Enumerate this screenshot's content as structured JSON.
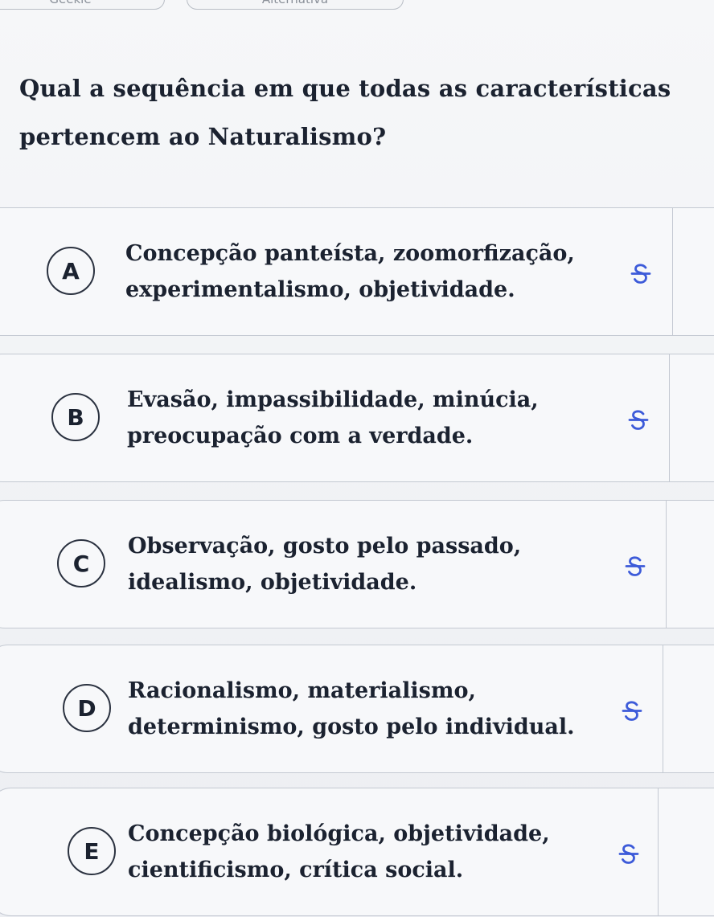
{
  "tabs": {
    "left_label": "Geekie",
    "right_label": "Alternativa"
  },
  "question": {
    "text": "Qual a sequência em que todas as características pertencem ao Naturalismo?"
  },
  "options": [
    {
      "letter": "A",
      "line1": "Concepção panteísta, zoomorfização,",
      "line2": "experimentalismo, objetividade."
    },
    {
      "letter": "B",
      "line1": "Evasão, impassibilidade, minúcia,",
      "line2": "preocupação com a verdade."
    },
    {
      "letter": "C",
      "line1": "Observação, gosto pelo passado,",
      "line2": "idealismo, objetividade."
    },
    {
      "letter": "D",
      "line1": "Racionalismo, materialismo,",
      "line2": "determinismo, gosto pelo individual."
    },
    {
      "letter": "E",
      "line1": "Concepção biológica, objetividade,",
      "line2": "cientificismo, crítica social."
    }
  ],
  "strike_icon": "strikethrough-s-icon",
  "colors": {
    "accent": "#3d5bd9",
    "text": "#1b2230",
    "border": "#c4c9d2"
  }
}
